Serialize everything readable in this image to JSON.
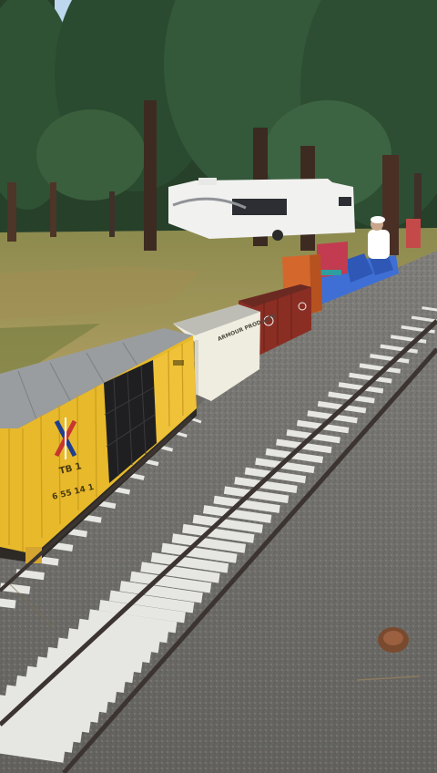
{
  "scene": {
    "sky_color": "#cfe3f5",
    "grass_color": "#a99a5c",
    "gravel_color": "#6e6d69",
    "tie_color": "#e6e6e2",
    "rail_color": "#3c3430"
  },
  "boxcar_yellow": {
    "body_color": "#e7b92b",
    "roof_color": "#9a9d9f",
    "reporting_mark": "TB 1",
    "car_number": "6 55 14 1",
    "icon": "cross-logo-icon"
  },
  "boxcar_white": {
    "body_color": "#efece0",
    "side_text": "ARMOUR PRODUCTS"
  },
  "boxcar_red": {
    "body_color": "#8a2e24"
  },
  "gondola": {
    "body_color": "#d4682c"
  },
  "riding_car": {
    "body_color": "#c23b50",
    "seat_color": "#3f6fd4"
  },
  "rv_trailer": {
    "body_color": "#f1f1ef"
  },
  "operator": {
    "shirt_color": "#ffffff",
    "cap_color": "#ffffff"
  }
}
